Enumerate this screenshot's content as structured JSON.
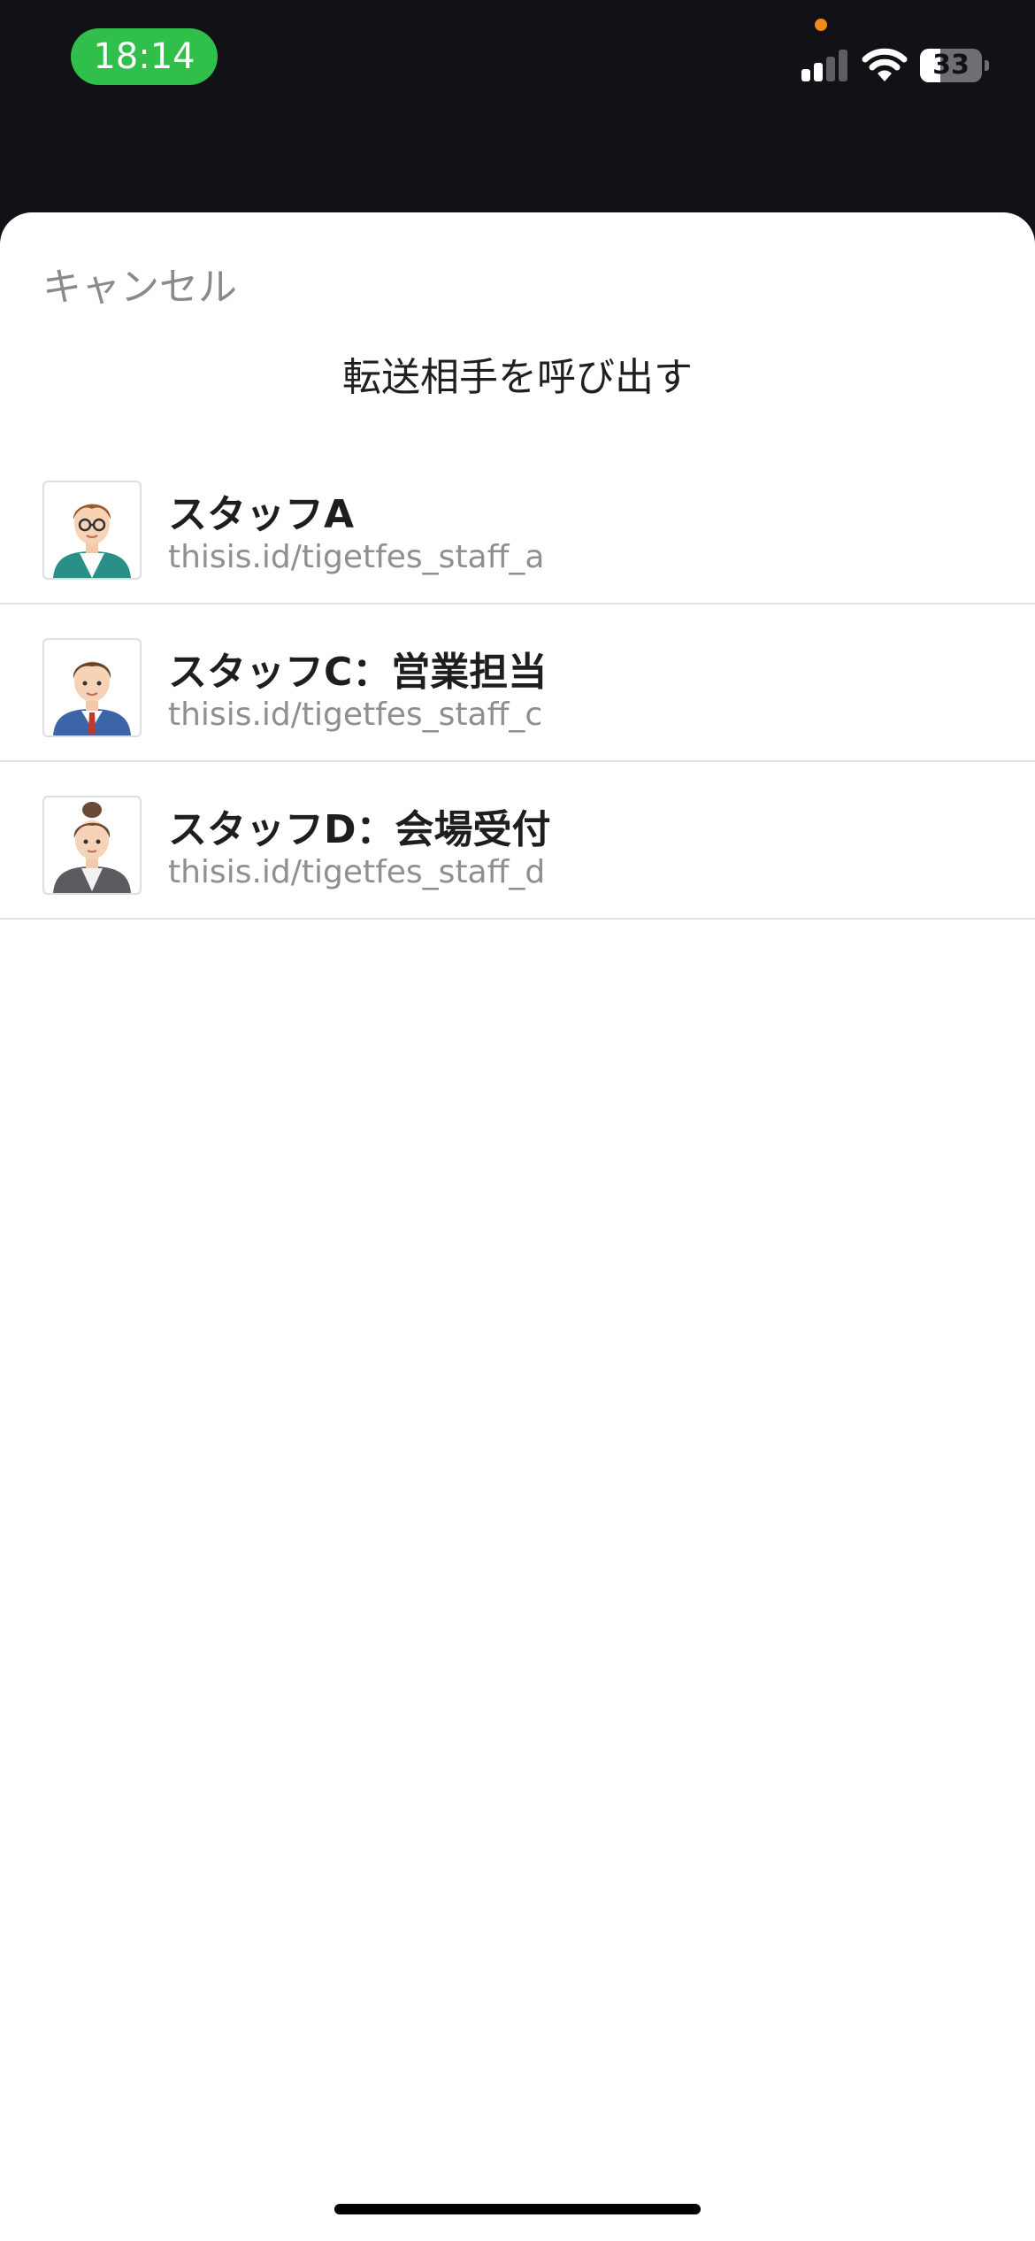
{
  "status_bar": {
    "time": "18:14",
    "battery_level": "33",
    "battery_percent": 33,
    "signal_bars_active": 2,
    "signal_bars_total": 4,
    "icons": [
      "signal-icon",
      "wifi-icon",
      "battery-icon"
    ],
    "colors": {
      "time_pill": "#2fbf4a",
      "privacy_dot": "#f28a1c"
    }
  },
  "sheet": {
    "cancel_label": "キャンセル",
    "title": "転送相手を呼び出す"
  },
  "contacts": [
    {
      "name": "スタッフA",
      "url": "thisis.id/tigetfes_staff_a",
      "avatar": "man-glasses-teal-jacket"
    },
    {
      "name": "スタッフC：営業担当",
      "url": "thisis.id/tigetfes_staff_c",
      "avatar": "man-blue-suit-red-tie"
    },
    {
      "name": "スタッフD：会場受付",
      "url": "thisis.id/tigetfes_staff_d",
      "avatar": "woman-bun-gray-jacket"
    }
  ]
}
